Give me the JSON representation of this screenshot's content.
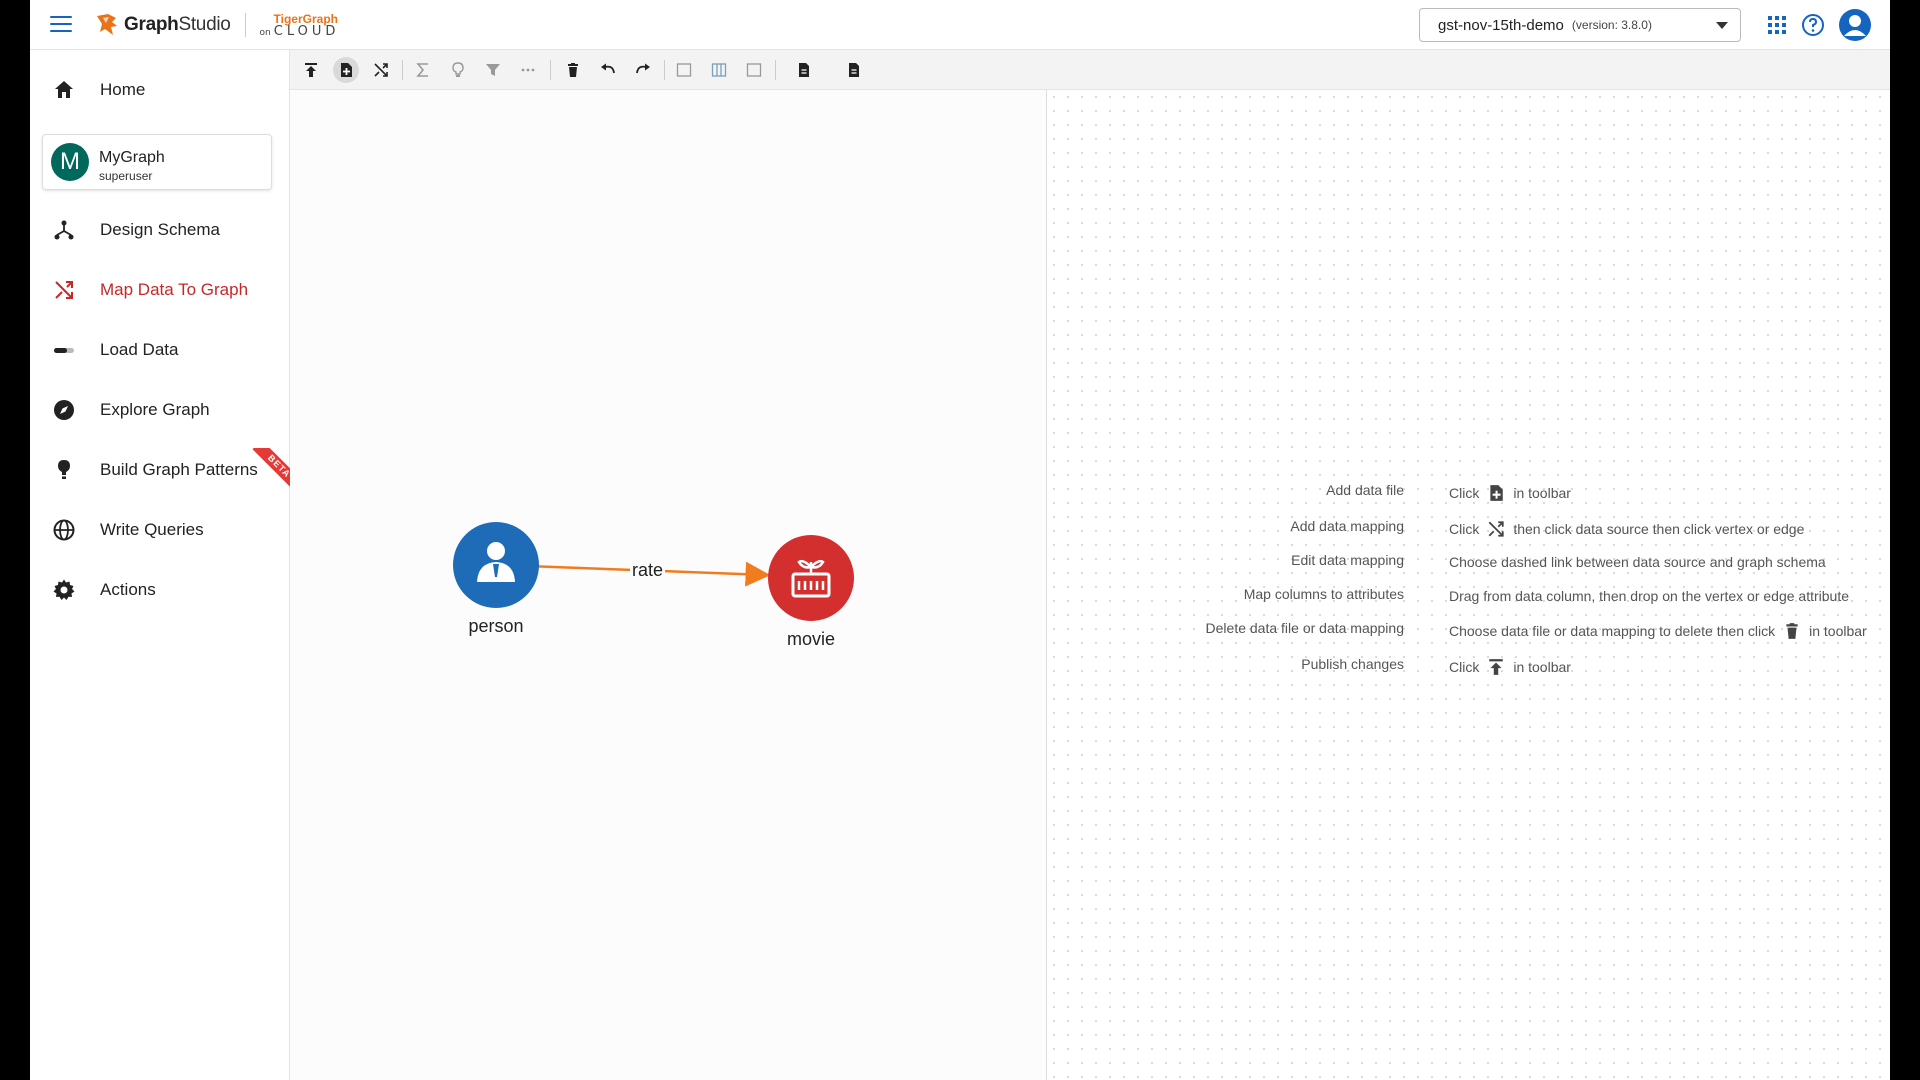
{
  "topbar": {
    "app_name_bold": "Graph",
    "app_name_rest": "Studio",
    "cloud_brand_top": "TigerGraph",
    "cloud_brand_on": "on",
    "cloud_brand_bottom": "CLOUD",
    "graph_selector": {
      "value": "gst-nov-15th-demo",
      "version": "(version: 3.8.0)"
    },
    "icons": [
      "apps-grid-icon",
      "help-icon",
      "account-icon"
    ]
  },
  "sidebar": {
    "graph": {
      "initial": "M",
      "name": "MyGraph",
      "role": "superuser"
    },
    "items": [
      {
        "label": "Home",
        "icon": "home-icon"
      },
      {
        "label": "Design Schema",
        "icon": "schema-icon"
      },
      {
        "label": "Map Data To Graph",
        "icon": "shuffle-icon",
        "active": true
      },
      {
        "label": "Load Data",
        "icon": "progress-icon"
      },
      {
        "label": "Explore Graph",
        "icon": "compass-icon"
      },
      {
        "label": "Build Graph Patterns",
        "icon": "lightbulb-icon",
        "badge": "BETA"
      },
      {
        "label": "Write Queries",
        "icon": "globe-icon"
      },
      {
        "label": "Actions",
        "icon": "gear-icon"
      }
    ]
  },
  "toolbar": {
    "tools": [
      "publish-icon",
      "add-data-file-icon",
      "map-data-icon",
      "sum-icon",
      "lightbulb-icon",
      "filter-icon",
      "more-icon",
      "delete-icon",
      "undo-icon",
      "redo-icon",
      "panel-left-icon",
      "panel-split-icon",
      "panel-right-icon",
      "document-icon",
      "document-alt-icon"
    ]
  },
  "graph": {
    "vertices": [
      {
        "name": "person",
        "color": "#1e6bb8"
      },
      {
        "name": "movie",
        "color": "#d32f2f"
      }
    ],
    "edges": [
      {
        "name": "rate",
        "color": "#f07c1e"
      }
    ]
  },
  "help": [
    {
      "label": "Add data file",
      "pre": "Click",
      "icon": "add-data-file-icon",
      "post": "in toolbar"
    },
    {
      "label": "Add data mapping",
      "pre": "Click",
      "icon": "map-data-icon",
      "post": "then click data source then click vertex or edge"
    },
    {
      "label": "Edit data mapping",
      "pre": "Choose dashed link between data source and graph schema",
      "icon": "",
      "post": ""
    },
    {
      "label": "Map columns to attributes",
      "pre": "Drag from data column, then drop on the vertex or edge attribute",
      "icon": "",
      "post": ""
    },
    {
      "label": "Delete data file or data mapping",
      "pre": "Choose data file or data mapping to delete then click",
      "icon": "delete-icon",
      "post": "in toolbar"
    },
    {
      "label": "Publish changes",
      "pre": "Click",
      "icon": "publish-icon",
      "post": "in toolbar"
    }
  ],
  "colors": {
    "accent_active": "#c62828",
    "brand_orange": "#e8731a",
    "link_blue": "#1565c0"
  }
}
